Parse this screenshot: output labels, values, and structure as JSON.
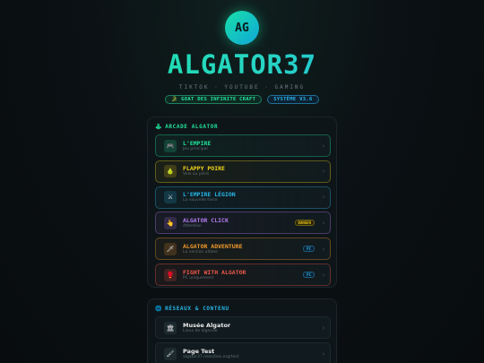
{
  "header": {
    "avatar_text": "AG",
    "title": "ALGATOR37",
    "subtitle": "TIKTOK · YOUTUBE · GAMING",
    "pill_goat": "🐊 GOAT DES INFINITE CRAFT",
    "pill_version": "SYSTÈME V3.6"
  },
  "arcade": {
    "heading_icon": "joystick-icon",
    "heading": "ARCADE ALGATOR",
    "items": [
      {
        "icon": "gamepad-icon",
        "glyph": "🎮",
        "title": "L'EMPIRE",
        "desc": "Jeu principal",
        "color": "#22e39b",
        "badge": null
      },
      {
        "icon": "pear-icon",
        "glyph": "🍐",
        "title": "FLAPPY POIRE",
        "desc": "Vole ou péris",
        "color": "#f2d51c",
        "badge": null
      },
      {
        "icon": "swords-icon",
        "glyph": "⚔",
        "title": "L'EMPIRE LÉGION",
        "desc": "La nouvelle force",
        "color": "#28b6e8",
        "badge": null
      },
      {
        "icon": "click-icon",
        "glyph": "👆",
        "title": "ALGATOR CLICK",
        "desc": "Attention",
        "color": "#b57cf2",
        "badge": "DANGER"
      },
      {
        "icon": "sword-icon",
        "glyph": "🗡",
        "title": "ALGATOR ADVENTURE",
        "desc": "La version ultime",
        "color": "#f29a2e",
        "badge": "PC"
      },
      {
        "icon": "boxing-icon",
        "glyph": "🥊",
        "title": "FIGHT WITH ALGATOR",
        "desc": "PC uniquement",
        "color": "#f05a4a",
        "badge": "PC"
      }
    ]
  },
  "networks": {
    "heading_icon": "globe-icon",
    "heading": "RÉSEAUX & CONTENU",
    "items": [
      {
        "icon": "museum-icon",
        "glyph": "🏛",
        "title": "Musée Algator",
        "desc": "Lieux de légende",
        "color": "#e9e9e9"
      },
      {
        "icon": "brush-icon",
        "glyph": "🖌",
        "title": "Page Test",
        "desc": "algator37.neocities.org/test",
        "color": "#e9e9e9"
      }
    ]
  },
  "colors": {
    "accent_green": "#22e39b",
    "accent_blue": "#28b6e8",
    "danger": "#e6c21a"
  }
}
